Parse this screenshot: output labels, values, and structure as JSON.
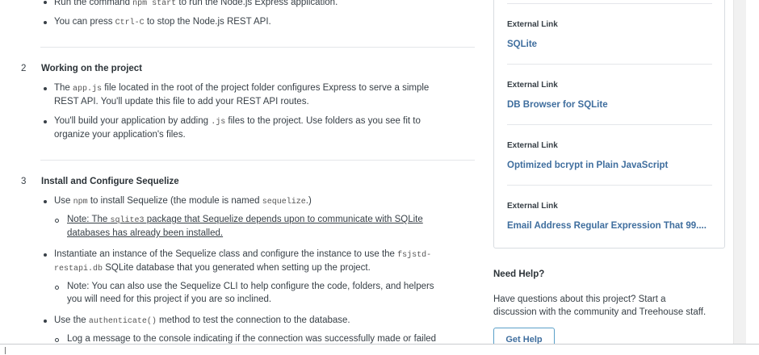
{
  "instructions": {
    "top_bullets": [
      {
        "pre": "Run the command ",
        "code": "npm start",
        "post": " to run the Node.js Express application."
      },
      {
        "pre": "You can press ",
        "code": "Ctrl-C",
        "post": " to stop the Node.js REST API."
      }
    ],
    "steps": [
      {
        "number": "2",
        "title": "Working on the project",
        "bullets": [
          {
            "line1_pre": "The ",
            "line1_code": "app.js",
            "line1_post": " file located in the root of the project folder configures Express to serve a simple",
            "line2": "REST API. You'll update this file to add your REST API routes."
          },
          {
            "line1_pre": "You'll build your application by adding ",
            "line1_code": ".js",
            "line1_post": " files to the project. Use folders as you see fit to",
            "line2": "organize your application's files."
          }
        ]
      },
      {
        "number": "3",
        "title": "Install and Configure Sequelize",
        "b1_pre": "Use ",
        "b1_code1": "npm",
        "b1_mid": " to install Sequelize (the module is named ",
        "b1_code2": "sequelize",
        "b1_post": ".)",
        "b1_sub_pre": "Note: The ",
        "b1_sub_code": "sqlite3",
        "b1_sub_post": " package that Sequelize depends upon to communicate with SQLite",
        "b1_sub_line2": "databases has already been installed.",
        "b2_pre": "Instantiate an instance of the Sequelize class and configure the instance to use the ",
        "b2_code1": "fsjstd-",
        "b2_code2": "restapi.db",
        "b2_post": " SQLite database that you generated when setting up the project.",
        "b2_sub_line1": "Note: You can also use the Sequelize CLI to help configure the code, folders, and helpers",
        "b2_sub_line2": "you will need for this project if you are so inclined.",
        "b3_pre": "Use the ",
        "b3_code": "authenticate()",
        "b3_post": " method to test the connection to the database.",
        "b3_sub": "Log a message to the console indicating if the connection was successfully made or failed"
      }
    ]
  },
  "resources": [
    {
      "label": "External Link",
      "title": "SQLite"
    },
    {
      "label": "External Link",
      "title": "DB Browser for SQLite"
    },
    {
      "label": "External Link",
      "title": "Optimized bcrypt in Plain JavaScript"
    },
    {
      "label": "External Link",
      "title": "Email Address Regular Expression That 99...."
    }
  ],
  "help": {
    "title": "Need Help?",
    "line1": "Have questions about this project? Start a",
    "line2": "discussion with the community and Treehouse staff.",
    "button": "Get Help"
  }
}
